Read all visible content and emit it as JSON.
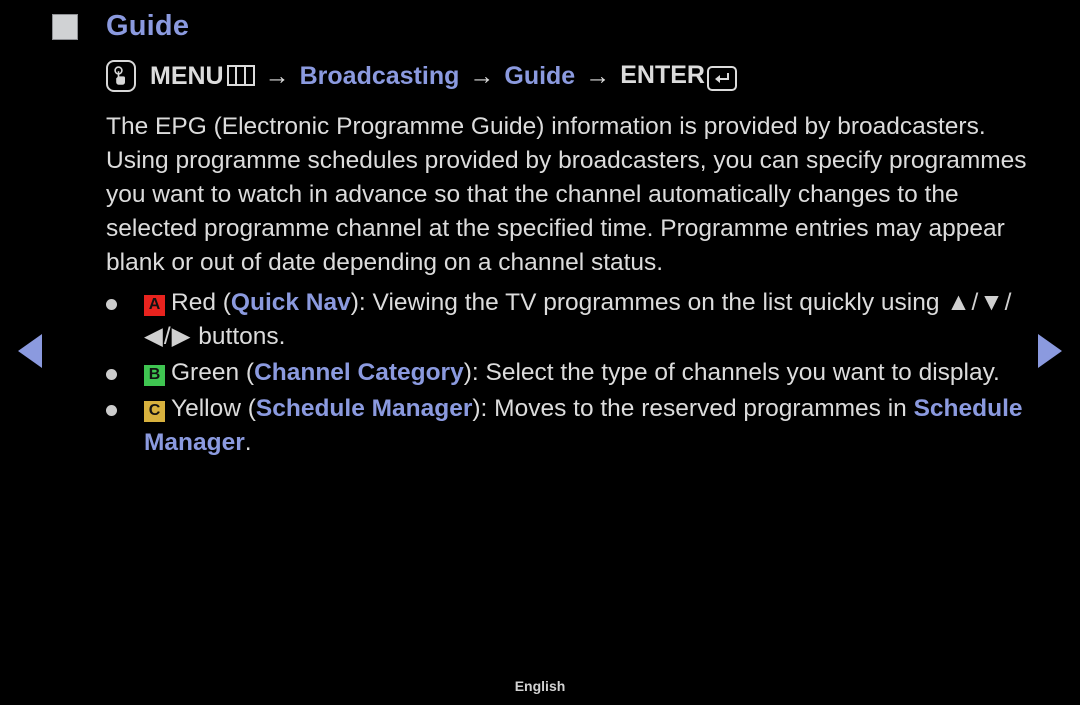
{
  "header": {
    "title": "Guide",
    "bullet_icon": "filled-square-icon"
  },
  "menu_path": {
    "touch_icon": "hand-press-icon",
    "menu_label": "MENU",
    "menu_icon": "three-column-menu-icon",
    "arrow1": "→",
    "broadcasting_label": "Broadcasting",
    "arrow2": "→",
    "guide_label": "Guide",
    "arrow3": "→",
    "enter_label": "ENTER",
    "enter_icon": "enter-return-icon"
  },
  "description": "The EPG (Electronic Programme Guide) information is provided by broadcasters. Using programme schedules provided by broadcasters, you can specify programmes you want to watch in advance so that the channel automatically changes to the selected programme channel at the specified time. Programme entries may appear blank or out of date depending on a channel status.",
  "bullets": [
    {
      "badge": "A",
      "badge_color": "#e8231e",
      "badge_text_color": "#121212",
      "color_name": "Red",
      "open_paren": " (",
      "feature": "Quick Nav",
      "close_paren": "): ",
      "text_before_arrows": "Viewing the TV programmes on the list quickly using ",
      "arrows": "▲/▼/◀/▶",
      "text_after_arrows": " buttons."
    },
    {
      "badge": "B",
      "badge_color": "#3fc551",
      "badge_text_color": "#121212",
      "color_name": "Green",
      "open_paren": " (",
      "feature": "Channel Category",
      "close_paren": "): ",
      "text_body": "Select the type of channels you want to display."
    },
    {
      "badge": "C",
      "badge_color": "#d7b13e",
      "badge_text_color": "#121212",
      "color_name": "Yellow",
      "open_paren": " (",
      "feature": "Schedule Manager",
      "close_paren": "): ",
      "text_body": "Moves to the reserved programmes in ",
      "trailing_link": "Schedule Manager",
      "trailing_period": "."
    }
  ],
  "navigation": {
    "prev_icon": "left-triangle-icon",
    "next_icon": "right-triangle-icon"
  },
  "footer": {
    "language": "English"
  },
  "colors": {
    "background": "#000000",
    "accent": "#8b9adf",
    "body_text": "#dcdcdc"
  }
}
